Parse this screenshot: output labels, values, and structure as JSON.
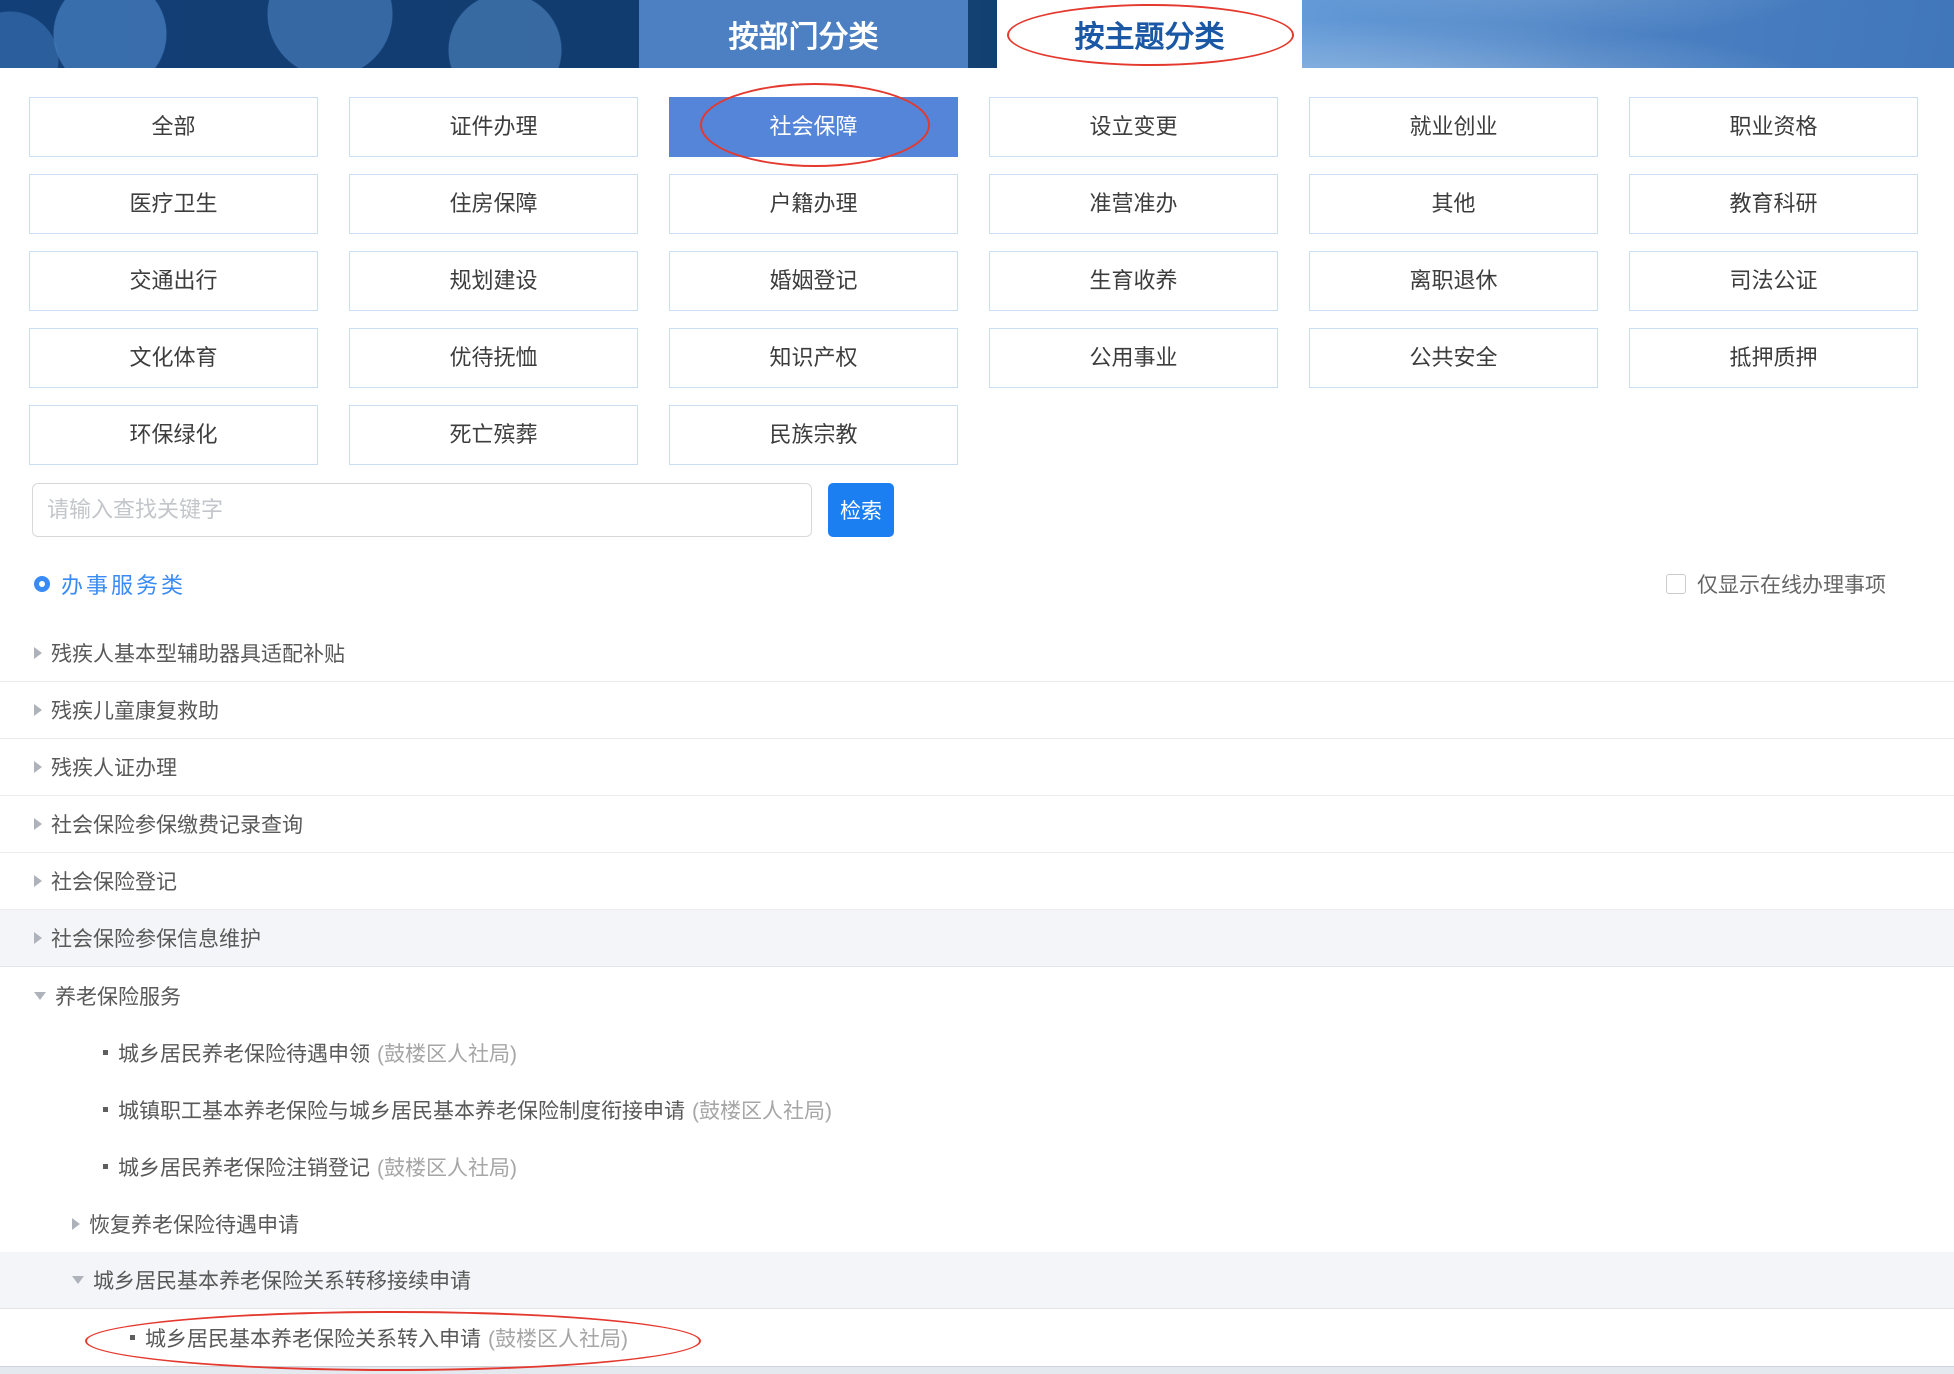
{
  "banner": {
    "tab_department": "按部门分类",
    "tab_theme": "按主题分类"
  },
  "categories": {
    "selected": "社会保障",
    "circled": "社会保障",
    "items": [
      "全部",
      "证件办理",
      "社会保障",
      "设立变更",
      "就业创业",
      "职业资格",
      "医疗卫生",
      "住房保障",
      "户籍办理",
      "准营准办",
      "其他",
      "教育科研",
      "交通出行",
      "规划建设",
      "婚姻登记",
      "生育收养",
      "离职退休",
      "司法公证",
      "文化体育",
      "优待抚恤",
      "知识产权",
      "公用事业",
      "公共安全",
      "抵押质押",
      "环保绿化",
      "死亡殡葬",
      "民族宗教"
    ]
  },
  "search": {
    "placeholder": "请输入查找关键字",
    "button": "检索"
  },
  "filter": {
    "section_label": "办事服务类",
    "checkbox_label": "仅显示在线办理事项",
    "checked": false
  },
  "services": [
    {
      "label": "残疾人基本型辅助器具适配补贴",
      "level": 0,
      "marker": "collapsed",
      "sep": true
    },
    {
      "label": "残疾儿童康复救助",
      "level": 0,
      "marker": "collapsed",
      "sep": true
    },
    {
      "label": "残疾人证办理",
      "level": 0,
      "marker": "collapsed",
      "sep": true
    },
    {
      "label": "社会保险参保缴费记录查询",
      "level": 0,
      "marker": "collapsed",
      "sep": true
    },
    {
      "label": "社会保险登记",
      "level": 0,
      "marker": "collapsed",
      "sep": true
    },
    {
      "label": "社会保险参保信息维护",
      "level": 0,
      "marker": "collapsed",
      "highlighted": true
    },
    {
      "label": "养老保险服务",
      "level": 0,
      "marker": "expanded"
    },
    {
      "label": "城乡居民养老保险待遇申领",
      "org": "(鼓楼区人社局)",
      "level": 1,
      "marker": "bullet"
    },
    {
      "label": "城镇职工基本养老保险与城乡居民基本养老保险制度衔接申请",
      "org": "(鼓楼区人社局)",
      "level": 1,
      "marker": "bullet"
    },
    {
      "label": "城乡居民养老保险注销登记",
      "org": "(鼓楼区人社局)",
      "level": 1,
      "marker": "bullet"
    },
    {
      "label": "恢复养老保险待遇申请",
      "level": 1,
      "marker": "collapsed"
    },
    {
      "label": "城乡居民基本养老保险关系转移接续申请",
      "level": 1,
      "marker": "expanded",
      "highlighted": true
    },
    {
      "label": "城乡居民基本养老保险关系转入申请",
      "org": "(鼓楼区人社局)",
      "level": 2,
      "marker": "bullet",
      "circled": true
    }
  ],
  "annotations": {
    "circled_tab": "按主题分类",
    "circled_category": "社会保障",
    "circled_service": "城乡居民基本养老保险关系转入申请",
    "annotation_color": "#e4392e"
  },
  "colors": {
    "selected_category_bg": "#5585d8",
    "search_button_bg": "#1b7ff2",
    "section_link_blue": "#3a8af5",
    "banner_dark_blue": "#113c6f",
    "banner_tab_blue": "#4d80c2"
  }
}
